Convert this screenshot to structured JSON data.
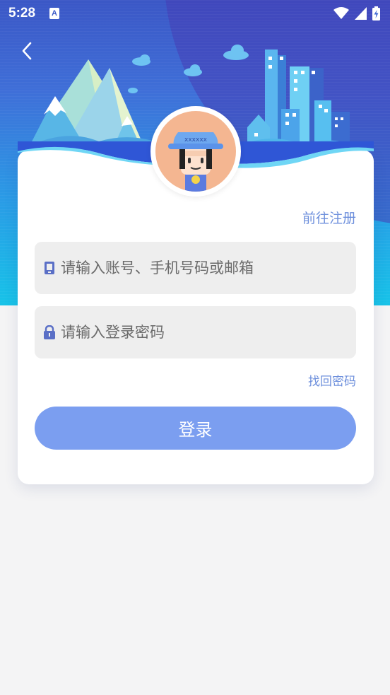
{
  "status_bar": {
    "time": "5:28",
    "notification_glyph": "A"
  },
  "nav": {
    "back_icon": "chevron-left-icon"
  },
  "avatar": {
    "hat_text": "xxxxxx"
  },
  "links": {
    "register": "前往注册",
    "forgot_password": "找回密码"
  },
  "form": {
    "account_placeholder": "请输入账号、手机号码或邮箱",
    "account_value": "",
    "account_icon": "phone-icon",
    "password_placeholder": "请输入登录密码",
    "password_value": "",
    "password_icon": "lock-icon",
    "submit_label": "登录"
  },
  "colors": {
    "accent": "#7b9ef0",
    "link": "#6d8fdc",
    "icon": "#5a6fc6",
    "hero_top": "#3b57c6",
    "hero_bottom": "#17c3e8"
  }
}
